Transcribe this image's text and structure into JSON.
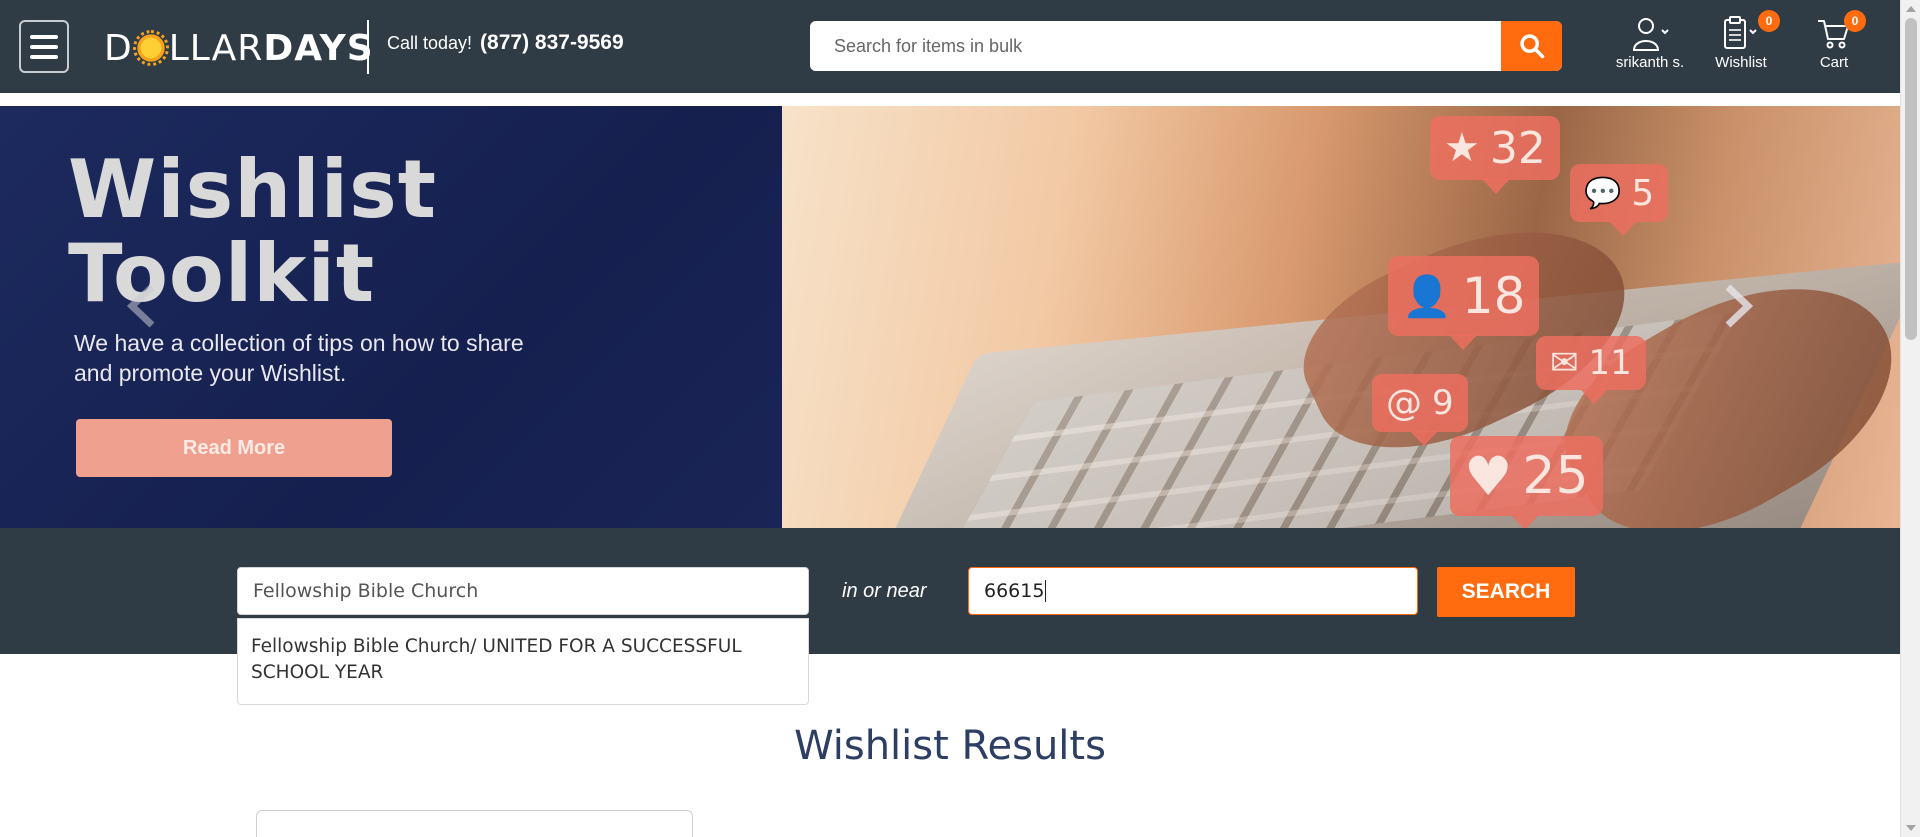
{
  "header": {
    "logo_part1": "D",
    "logo_part2": "LLAR",
    "logo_part3": "DAYS",
    "call_label": "Call today!",
    "phone": "(877) 837-9569",
    "search_placeholder": "Search for items in bulk",
    "account_label": "srikanth s.",
    "wishlist_label": "Wishlist",
    "wishlist_count": "0",
    "cart_label": "Cart",
    "cart_count": "0"
  },
  "banner": {
    "title_line1": "Wishlist",
    "title_line2": "Toolkit",
    "text": "We have a collection of tips on how to share and promote your Wishlist.",
    "button": "Read More",
    "bubbles": [
      {
        "icon": "★",
        "value": "32"
      },
      {
        "icon": "💬",
        "value": "5"
      },
      {
        "icon": "👤",
        "value": "18"
      },
      {
        "icon": "✉",
        "value": "11"
      },
      {
        "icon": "@",
        "value": "9"
      },
      {
        "icon": "♥",
        "value": "25"
      }
    ]
  },
  "search_strip": {
    "name_value": "Fellowship Bible Church",
    "near_label": "in or near",
    "zip_value": "66615",
    "button": "SEARCH",
    "suggestion": "Fellowship Bible Church/ UNITED FOR A SUCCESSFUL SCHOOL YEAR"
  },
  "results": {
    "title": "Wishlist Results"
  },
  "colors": {
    "header_bg": "#2f3b45",
    "accent": "#ff6b0e",
    "banner_navy": "#15204f",
    "title_blue": "#2c3e64"
  }
}
